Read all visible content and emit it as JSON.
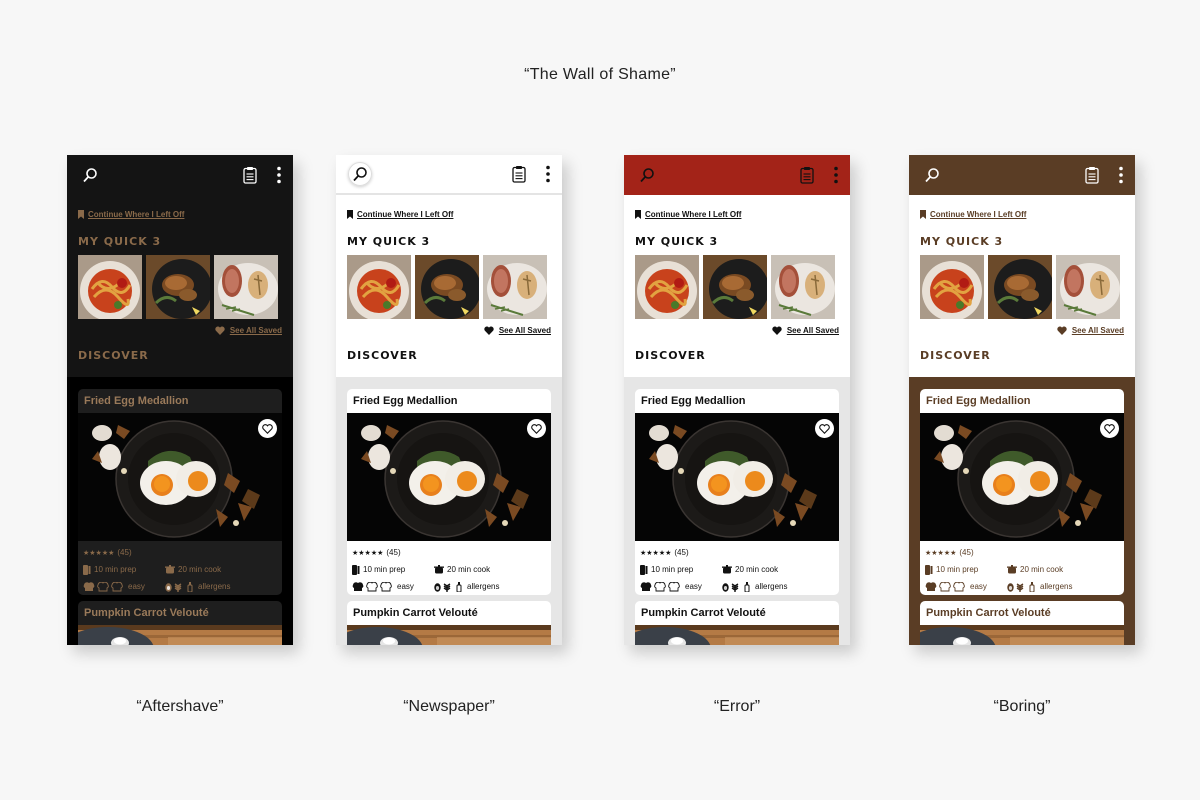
{
  "page_title": "“The Wall of Shame”",
  "app": {
    "continue_label": "Continue Where I Left Off",
    "quick_title": "MY QUICK 3",
    "see_all_label": "See All Saved",
    "discover_title": "DISCOVER",
    "card1": {
      "title": "Fried Egg Medallion",
      "rating": "★★★★★",
      "rating_count": "(45)",
      "prep": "10 min prep",
      "cook": "20 min cook",
      "difficulty": "easy",
      "allergens": "allergens"
    },
    "card2": {
      "title": "Pumpkin Carrot Velouté"
    }
  },
  "themes": [
    {
      "caption": "“Aftershave”",
      "topbar_color": "#141414",
      "header_color": "#141414",
      "feed_color": "#000000",
      "card_color": "#1e1e1e",
      "text_color": "#8a6a4a",
      "title_text": "#9a7a5a",
      "icon_color": "#ffffff"
    },
    {
      "caption": "“Newspaper”",
      "topbar_color": "#ffffff",
      "header_color": "#ffffff",
      "feed_color": "#e6e6e6",
      "card_color": "#ffffff",
      "text_color": "#111111",
      "title_text": "#111111",
      "icon_color": "#111111"
    },
    {
      "caption": "“Error”",
      "topbar_color": "#a32318",
      "header_color": "#ffffff",
      "feed_color": "#e6e6e6",
      "card_color": "#ffffff",
      "text_color": "#111111",
      "title_text": "#111111",
      "icon_color": "#111111"
    },
    {
      "caption": "“Boring”",
      "topbar_color": "#5a3d25",
      "header_color": "#ffffff",
      "feed_color": "#5a3d25",
      "card_color": "#ffffff",
      "text_color": "#5a3d25",
      "title_text": "#5a3d25",
      "icon_color": "#ffffff"
    }
  ]
}
